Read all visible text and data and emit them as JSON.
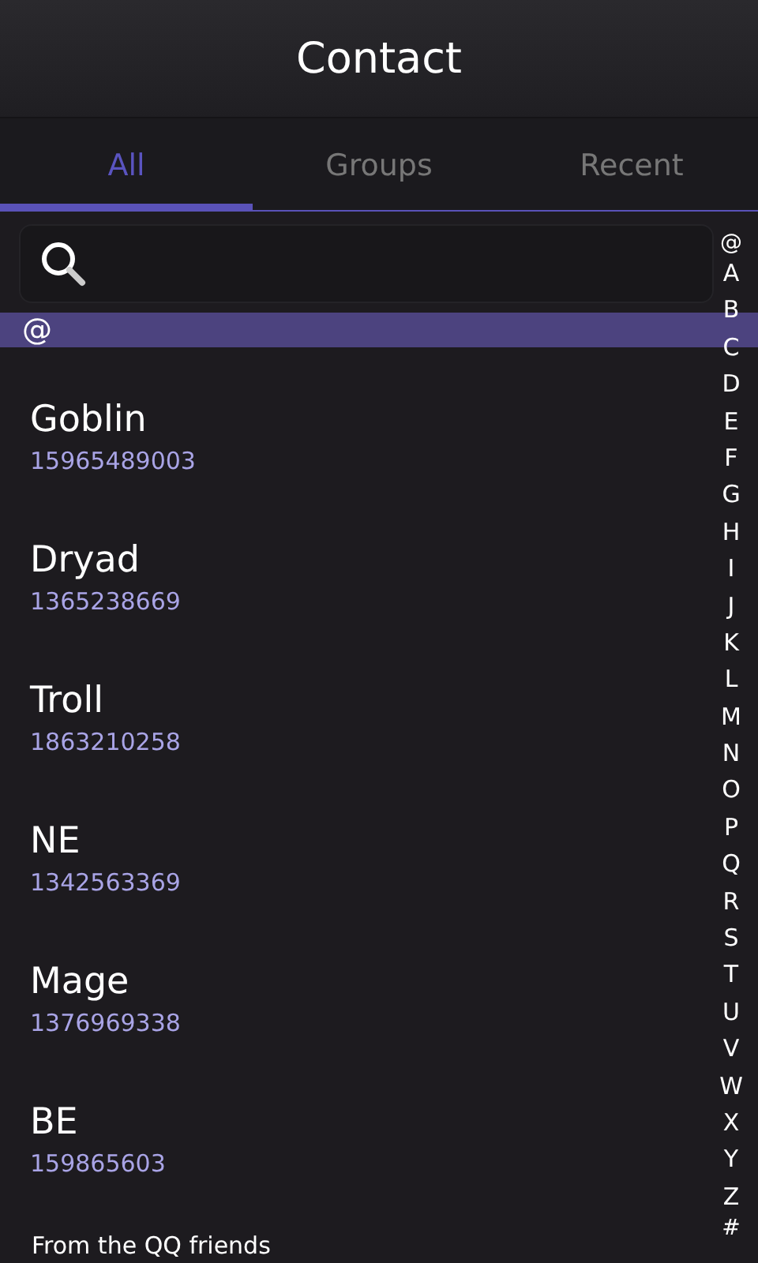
{
  "header": {
    "title": "Contact"
  },
  "tabs": [
    {
      "label": "All",
      "selected": true
    },
    {
      "label": "Groups",
      "selected": false
    },
    {
      "label": "Recent",
      "selected": false
    }
  ],
  "section": "@",
  "contacts": [
    {
      "name": "Goblin",
      "phone": "15965489003"
    },
    {
      "name": "Dryad",
      "phone": "1365238669"
    },
    {
      "name": "Troll",
      "phone": "1863210258"
    },
    {
      "name": "NE",
      "phone": "1342563369"
    },
    {
      "name": "Mage",
      "phone": "1376969338"
    },
    {
      "name": "BE",
      "phone": "159865603"
    }
  ],
  "footer_section": "From the QQ friends",
  "index": [
    "@",
    "A",
    "B",
    "C",
    "D",
    "E",
    "F",
    "G",
    "H",
    "I",
    "J",
    "K",
    "L",
    "M",
    "N",
    "O",
    "P",
    "Q",
    "R",
    "S",
    "T",
    "U",
    "V",
    "W",
    "X",
    "Y",
    "Z",
    "#"
  ]
}
